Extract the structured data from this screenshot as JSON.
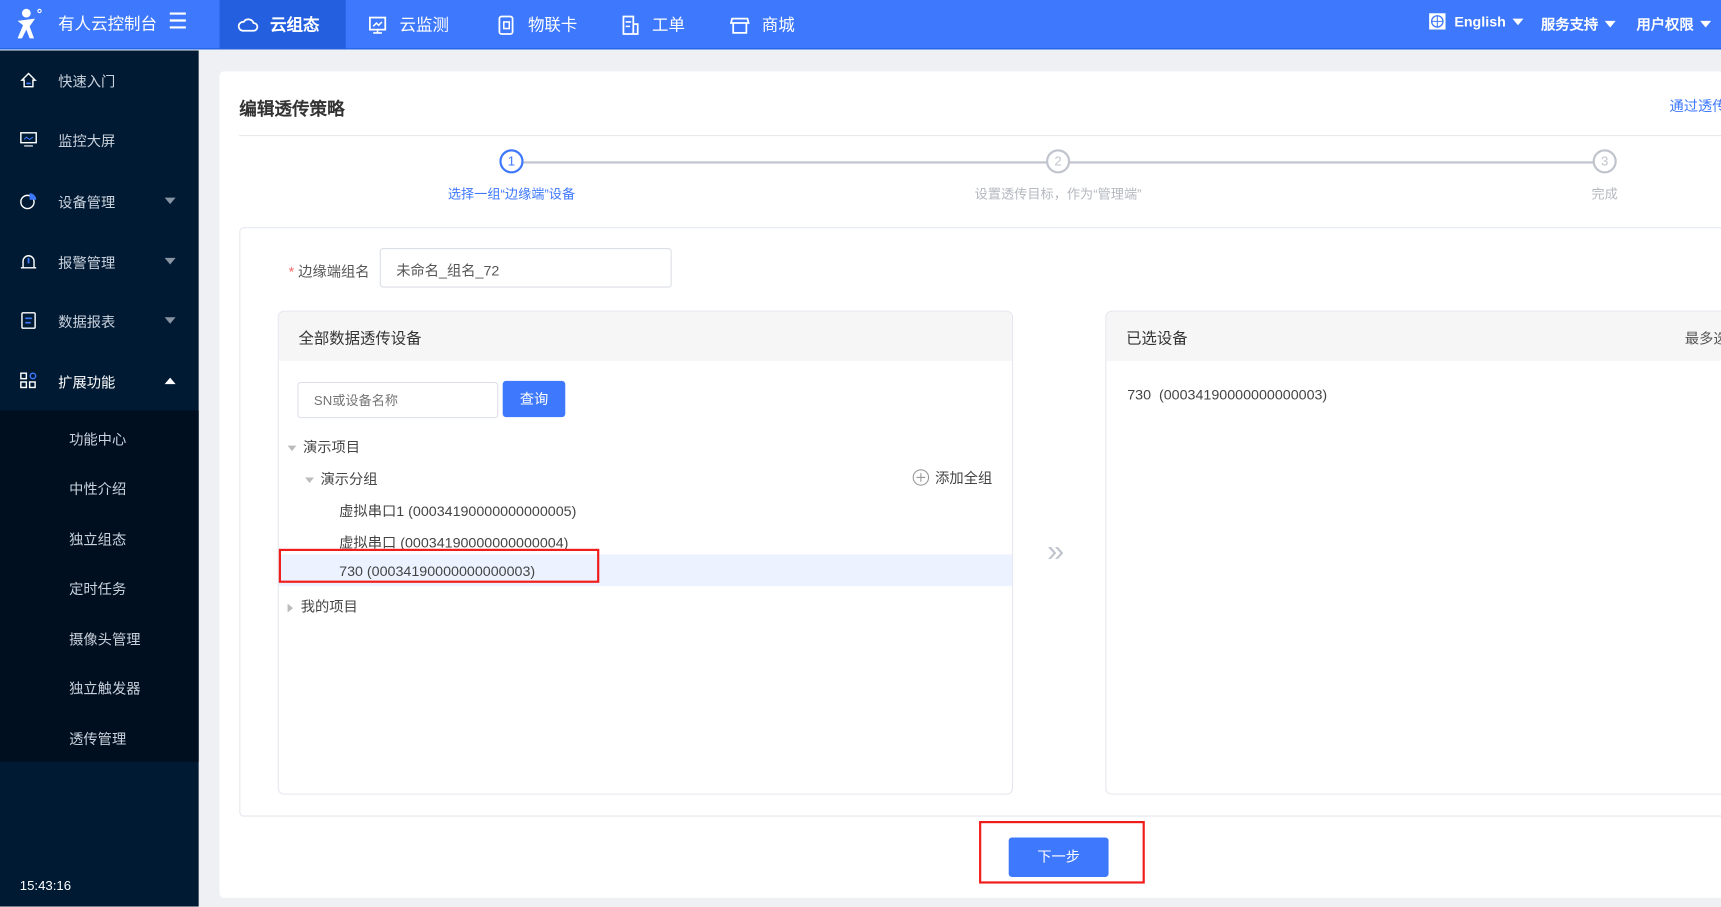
{
  "topbar": {
    "brand": "有人云控制台",
    "tabs": [
      {
        "label": "云组态",
        "icon": "cloud-icon",
        "active": true
      },
      {
        "label": "云监测",
        "icon": "monitor-icon"
      },
      {
        "label": "物联卡",
        "icon": "sim-card-icon"
      },
      {
        "label": "工单",
        "icon": "work-order-icon"
      },
      {
        "label": "商城",
        "icon": "shop-icon"
      }
    ],
    "language": "English",
    "support": "服务支持",
    "permissions": "用户权限"
  },
  "sidebar": {
    "items": [
      {
        "label": "快速入门",
        "icon": "home-icon"
      },
      {
        "label": "监控大屏",
        "icon": "screen-icon"
      },
      {
        "label": "设备管理",
        "icon": "pie-icon"
      },
      {
        "label": "报警管理",
        "icon": "alarm-icon"
      },
      {
        "label": "数据报表",
        "icon": "report-icon"
      },
      {
        "label": "扩展功能",
        "icon": "apps-icon"
      }
    ],
    "sub_items": [
      "功能中心",
      "中性介绍",
      "独立组态",
      "定时任务",
      "摄像头管理",
      "独立触发器",
      "透传管理"
    ],
    "time": "15:43:16"
  },
  "page": {
    "title": "编辑透传策略",
    "top_link": "通过透传",
    "steps": [
      {
        "num": "1",
        "label": "选择一组“边缘端”设备",
        "active": true
      },
      {
        "num": "2",
        "label": "设置透传目标，作为“管理端”"
      },
      {
        "num": "3",
        "label": "完成"
      }
    ],
    "group_name_label": "边缘端组名",
    "group_name_value": "未命名_组名_72",
    "left_panel": {
      "title": "全部数据透传设备",
      "search_placeholder": "SN或设备名称",
      "search_button": "查询",
      "tree": {
        "project1": "演示项目",
        "group1": "演示分组",
        "add_all": "添加全组",
        "devices": [
          "虚拟串口1 (00034190000000000005)",
          "虚拟串口 (00034190000000000004)",
          "730 (00034190000000000003)"
        ],
        "project2": "我的项目"
      }
    },
    "right_panel": {
      "title": "已选设备",
      "limit_text": "最多选",
      "selected": [
        "730  (00034190000000000003)"
      ]
    },
    "next_button": "下一步"
  },
  "colors": {
    "primary": "#3e78fd",
    "sidebar": "#011a33",
    "highlight": "#ecf2ff",
    "annotation": "#f01d1d"
  }
}
